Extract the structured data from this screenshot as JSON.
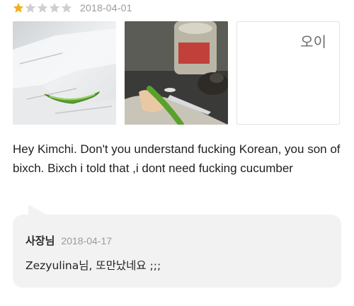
{
  "review": {
    "rating": 1,
    "max_rating": 5,
    "date": "2018-04-01",
    "colors": {
      "star_filled": "#f2b01e",
      "star_empty": "#cfcfcf"
    },
    "photos": [
      {
        "name": "cucumber-on-napkin-photo"
      },
      {
        "name": "cucumber-on-plate-photo"
      },
      {
        "memo_text": "오이"
      }
    ],
    "text": "Hey Kimchi. Don't you understand fucking Korean, you son of bixch. Bixch i told that ,i dont need fucking cucumber"
  },
  "reply": {
    "author": "사장님",
    "date": "2018-04-17",
    "text": "Zezyulina님, 또만났네요 ;;;"
  }
}
